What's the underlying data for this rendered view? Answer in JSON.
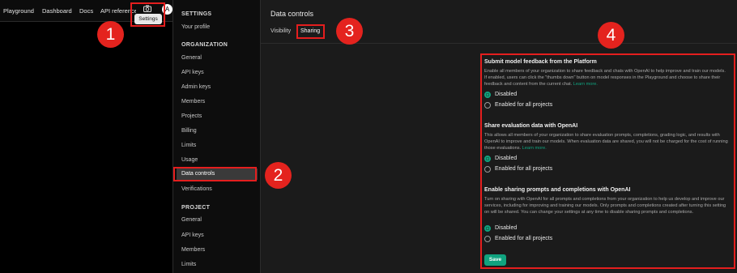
{
  "topnav": {
    "items": [
      "Playground",
      "Dashboard",
      "Docs",
      "API reference"
    ],
    "camera_icon": "camera-icon",
    "avatar_letter": "A",
    "tooltip": "Settings"
  },
  "sidebar": {
    "settings_header": "SETTINGS",
    "your_profile": "Your profile",
    "org_header": "ORGANIZATION",
    "org_items": [
      "General",
      "API keys",
      "Admin keys",
      "Members",
      "Projects",
      "Billing",
      "Limits",
      "Usage",
      "Data controls",
      "Verifications"
    ],
    "project_header": "PROJECT",
    "project_items": [
      "General",
      "API keys",
      "Members",
      "Limits"
    ]
  },
  "main": {
    "title": "Data controls",
    "tabs": [
      "Visibility",
      "Sharing"
    ],
    "sections": [
      {
        "heading": "Submit model feedback from the Platform",
        "description": "Enable all members of your organization to share feedback and chats with OpenAI to help improve and train our models. If enabled, users can click the \"thumbs down\" button on model responses in the Playground and choose to share their feedback and content from the current chat.",
        "learn_more": "Learn more.",
        "options": [
          "Disabled",
          "Enabled for all projects"
        ],
        "selected": "Disabled"
      },
      {
        "heading": "Share evaluation data with OpenAI",
        "description": "This allows all members of your organization to share evaluation prompts, completions, grading logic, and results with OpenAI to improve and train our models. When evaluation data are shared, you will not be charged for the cost of running those evaluations.",
        "learn_more": "Learn more.",
        "options": [
          "Disabled",
          "Enabled for all projects"
        ],
        "selected": "Disabled"
      },
      {
        "heading": "Enable sharing prompts and completions with OpenAI",
        "description": "Turn on sharing with OpenAI for all prompts and completions from your organization to help us develop and improve our services, including for improving and training our models. Only prompts and completions created after turning this setting on will be shared. You can change your settings at any time to disable sharing prompts and completions.",
        "learn_more": "",
        "options": [
          "Disabled",
          "Enabled for all projects"
        ],
        "selected": "Disabled"
      }
    ],
    "save_label": "Save"
  },
  "callouts": [
    "1",
    "2",
    "3",
    "4"
  ],
  "colors": {
    "highlight": "#e41e1e",
    "accent": "#10a37f",
    "badge": "#e4231e"
  }
}
